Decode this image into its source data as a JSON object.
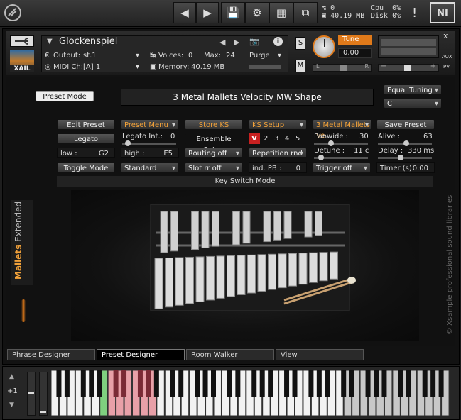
{
  "toolbar": {
    "voices_count": "0",
    "memory": "40.19 MB",
    "cpu_label": "Cpu",
    "cpu_value": "0%",
    "disk_label": "Disk",
    "disk_value": "0%",
    "warning": "!",
    "ni_logo": "NI"
  },
  "header": {
    "instrument_name": "Glockenspiel",
    "output_label": "Output:",
    "output_value": "st.1",
    "voices_label": "Voices:",
    "voices_value": "0",
    "max_label": "Max:",
    "max_value": "24",
    "purge_label": "Purge",
    "midi_label": "MIDI Ch:",
    "midi_value": "[A]  1",
    "memory_label": "Memory:",
    "memory_value": "40.19 MB",
    "tune_label": "Tune",
    "tune_value": "0.00",
    "s_label": "S",
    "m_label": "M",
    "pan_left": "L",
    "pan_right": "R",
    "aux_label": "AUX",
    "pv_label": "PV",
    "logo_text": "XAIL",
    "close": "x",
    "minus": "−",
    "plus": "+"
  },
  "panel": {
    "preset_mode": "Preset Mode",
    "preset_name": "3 Metal Mallets Velocity MW Shape",
    "tuning": "Equal Tuning",
    "key": "C",
    "edit_preset": "Edit Preset",
    "preset_menu": "Preset Menu",
    "store_ks": "Store KS",
    "ks_setup": "KS Setup",
    "mallets_short": "3 Metal Mallets Ve",
    "save_preset": "Save Preset",
    "legato": "Legato",
    "legato_int_label": "Legato Int.:",
    "legato_int_value": "0",
    "ensemble_setup": "Ensemble Setup",
    "v_label": "V",
    "num_2": "2",
    "num_3": "3",
    "num_4": "4",
    "num_5": "5",
    "panwide_label": "Panwide :",
    "panwide_value": "30",
    "alive_label": "Alive :",
    "alive_value": "63",
    "low_label": "low :",
    "low_value": "G2",
    "high_label": "high :",
    "high_value": "E5",
    "routing": "Routing off",
    "repetition": "Repetition rnd",
    "detune_label": "Detune :",
    "detune_value": "11 c",
    "delay_label": "Delay :",
    "delay_value": "330 ms",
    "toggle_mode": "Toggle Mode",
    "standard": "Standard",
    "slot_rr": "Slot rr off",
    "ind_pb_label": "ind. PB :",
    "ind_pb_value": "0",
    "trigger": "Trigger off",
    "timer_label": "Timer (s):",
    "timer_value": "0.00",
    "key_switch_mode": "Key Switch Mode",
    "side_title_1": "Mallets",
    "side_title_2": "Extended",
    "copyright": "© Xsample professional sound libraries"
  },
  "tabs": [
    "Phrase Designer",
    "Preset Designer",
    "Room Walker",
    "View"
  ],
  "keyboard": {
    "octave": "+1",
    "up": "▲",
    "down": "▼"
  },
  "colors": {
    "accent_orange": "#f2a23a",
    "key_range_red": "#e8a0a8",
    "key_green": "#7fd07f"
  }
}
